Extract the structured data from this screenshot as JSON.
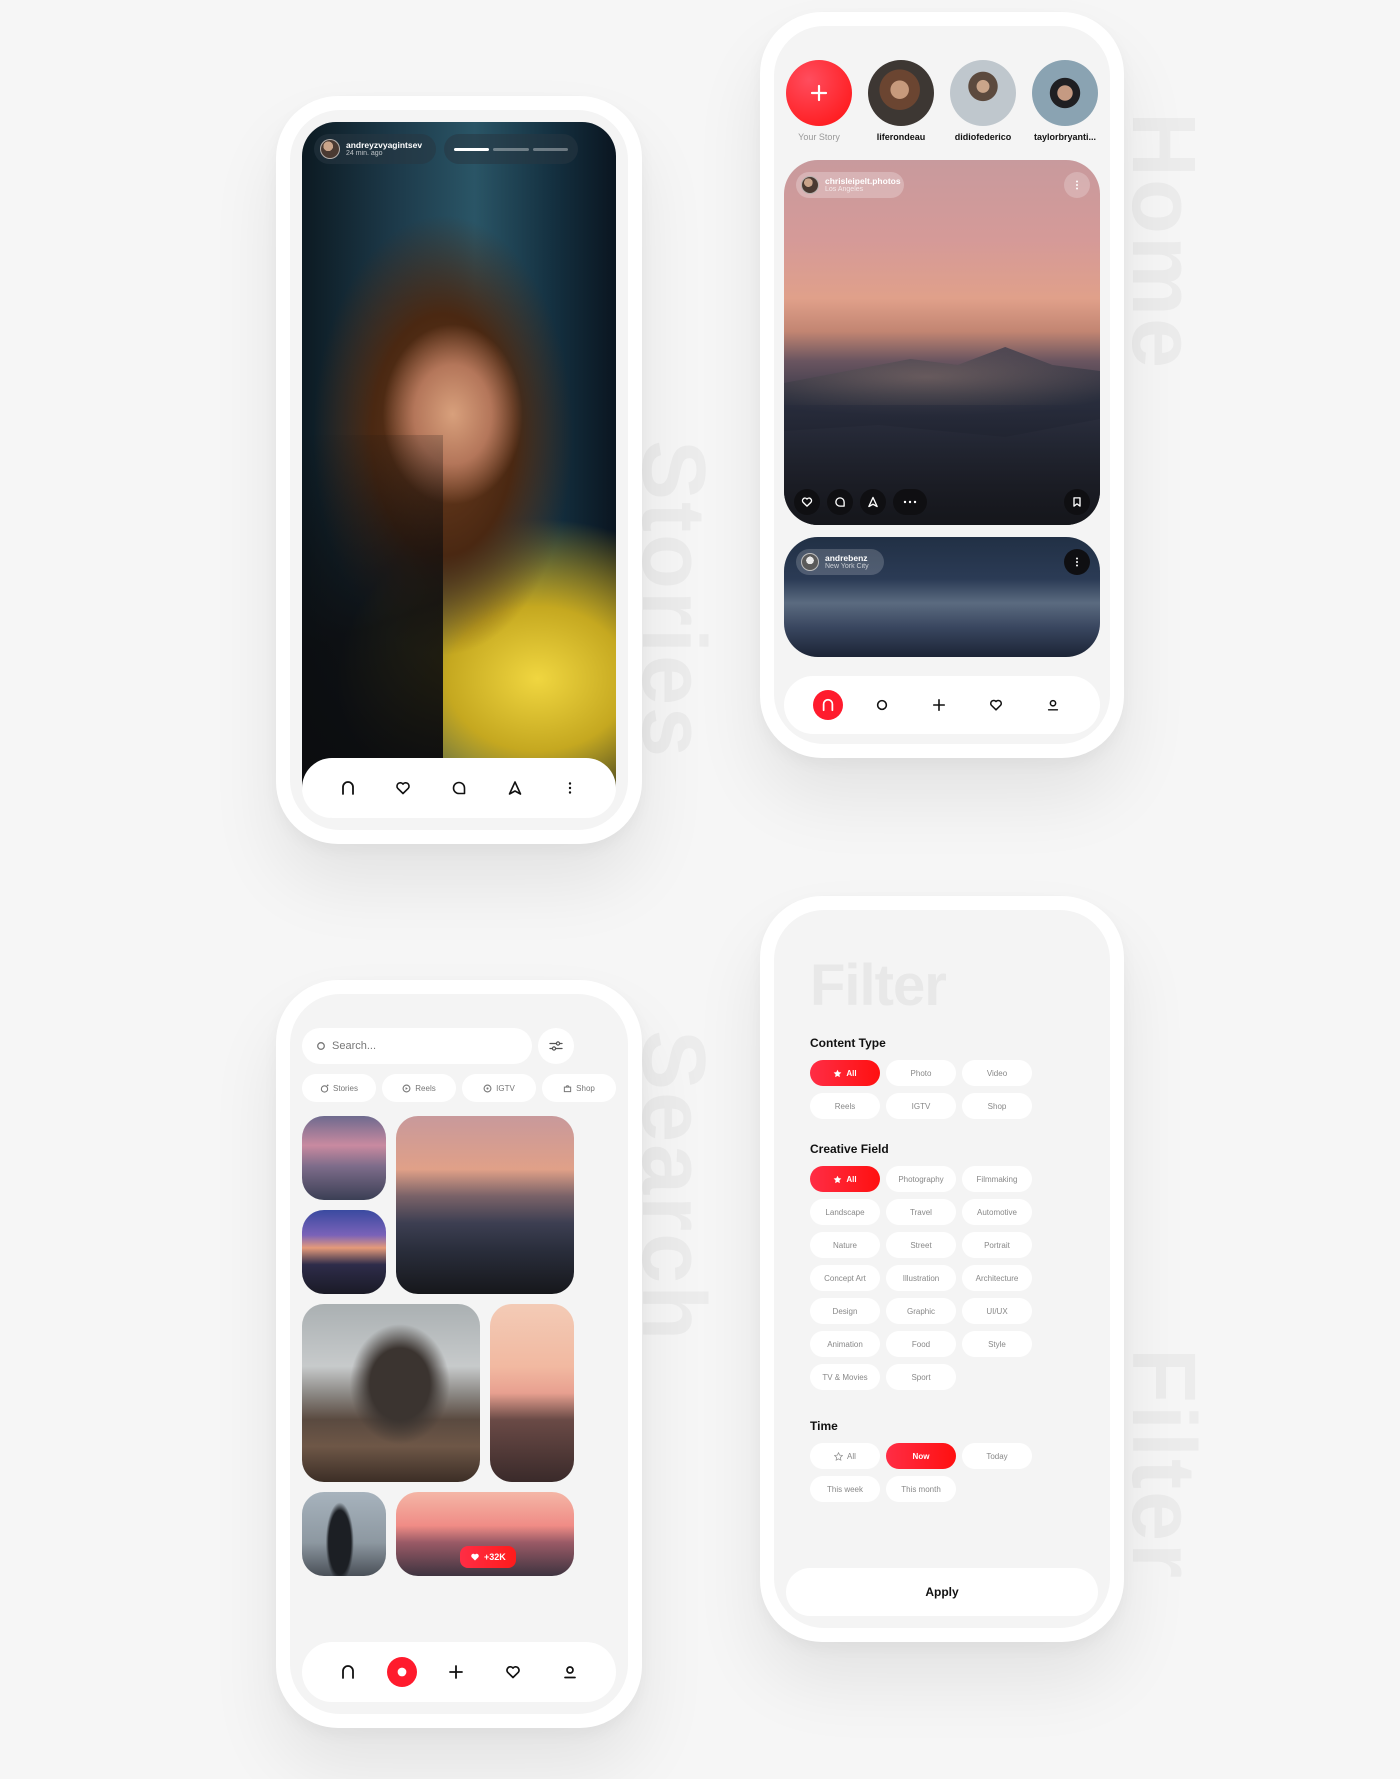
{
  "labels": {
    "stories": "Stories",
    "home": "Home",
    "search": "Search",
    "filter": "Filter"
  },
  "colors": {
    "accent": "#ff1b2d",
    "background": "#f6f6f6",
    "card": "#ffffff"
  },
  "stories_screen": {
    "username": "andreyzvyagintsev",
    "time": "24 min. ago",
    "progress_segments": 3,
    "progress_active": 1,
    "nav_icons": [
      "home-arch-icon",
      "heart-icon",
      "comment-icon",
      "send-icon",
      "more-icon"
    ]
  },
  "home_screen": {
    "stories": [
      {
        "label": "Your Story"
      },
      {
        "label": "liferondeau"
      },
      {
        "label": "didiofederico"
      },
      {
        "label": "taylorbryanti..."
      }
    ],
    "post1": {
      "username": "chrisleipelt.photos",
      "location": "Los Angeles"
    },
    "post2": {
      "username": "andrebenz",
      "location": "New York City"
    },
    "nav_icons": [
      "home-arch-icon",
      "search-circle-icon",
      "plus-icon",
      "heart-icon",
      "profile-icon"
    ]
  },
  "search_screen": {
    "placeholder": "Search...",
    "chips": [
      {
        "label": "Stories"
      },
      {
        "label": "Reels"
      },
      {
        "label": "IGTV"
      },
      {
        "label": "Shop"
      }
    ],
    "likes_badge": "+32K",
    "nav_icons": [
      "home-arch-icon",
      "record-icon",
      "plus-icon",
      "heart-icon",
      "profile-icon"
    ]
  },
  "filter_screen": {
    "title": "Filter",
    "content_type": {
      "heading": "Content Type",
      "options": [
        "All",
        "Photo",
        "Video",
        "Reels",
        "IGTV",
        "Shop"
      ],
      "selected": "All"
    },
    "creative_field": {
      "heading": "Creative Field",
      "options": [
        "All",
        "Photography",
        "Filmmaking",
        "Landscape",
        "Travel",
        "Automotive",
        "Nature",
        "Street",
        "Portrait",
        "Concept Art",
        "Illustration",
        "Architecture",
        "Design",
        "Graphic",
        "UI/UX",
        "Animation",
        "Food",
        "Style",
        "TV & Movies",
        "Sport"
      ],
      "selected": "All"
    },
    "time": {
      "heading": "Time",
      "options": [
        "All",
        "Now",
        "Today",
        "This week",
        "This month"
      ],
      "selected": "Now"
    },
    "apply_label": "Apply"
  }
}
